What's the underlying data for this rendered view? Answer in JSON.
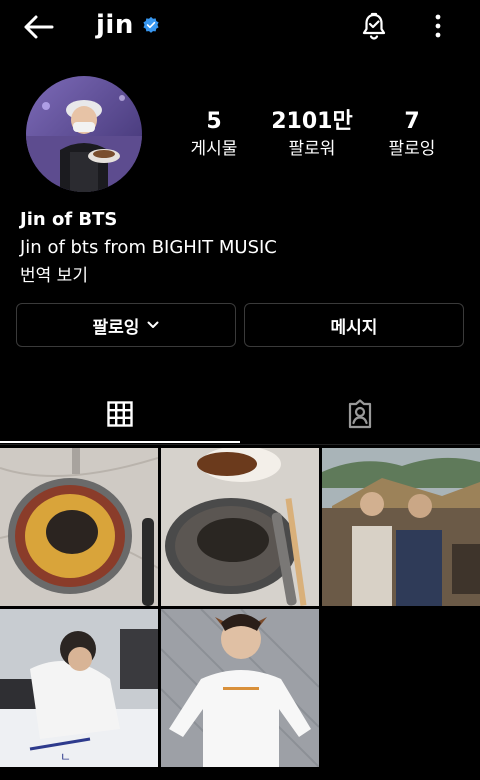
{
  "header": {
    "username": "jin",
    "icons": {
      "back": "back-arrow-icon",
      "verified": "verified-badge-icon",
      "notifications": "notification-bell-check-icon",
      "more": "more-vertical-icon"
    },
    "accent": "#3897f0"
  },
  "profile": {
    "stats": [
      {
        "value": "5",
        "label": "게시물"
      },
      {
        "value": "2101만",
        "label": "팔로워"
      },
      {
        "value": "7",
        "label": "팔로잉"
      }
    ],
    "display_name": "Jin of BTS",
    "bio": "Jin of bts from BIGHIT MUSIC",
    "translate_link": "번역 보기"
  },
  "actions": {
    "follow_label": "팔로잉",
    "message_label": "메시지"
  },
  "tabs": [
    {
      "icon": "grid-icon"
    },
    {
      "icon": "tagged-person-icon"
    }
  ],
  "posts": [
    {
      "icon": "photo-icon"
    },
    {
      "icon": "photo-icon"
    },
    {
      "icon": "photo-icon"
    },
    {
      "icon": "photo-icon"
    },
    {
      "icon": "photo-icon"
    }
  ]
}
